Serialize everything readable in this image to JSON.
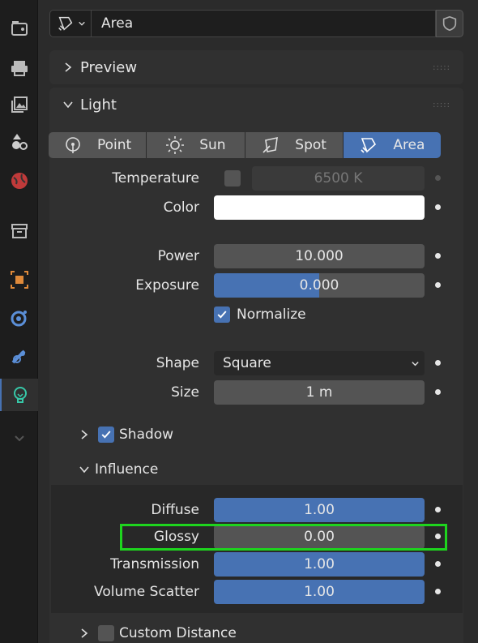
{
  "header": {
    "datablock_name": "Area",
    "icons": {
      "datablock": "area-light-icon",
      "fake_user": "shield-icon"
    }
  },
  "panels": {
    "preview": {
      "label": "Preview"
    },
    "light": {
      "label": "Light"
    }
  },
  "light_types": [
    {
      "label": "Point",
      "icon": "point-light-icon",
      "active": false
    },
    {
      "label": "Sun",
      "icon": "sun-light-icon",
      "active": false
    },
    {
      "label": "Spot",
      "icon": "spot-light-icon",
      "active": false
    },
    {
      "label": "Area",
      "icon": "area-light-icon",
      "active": true
    }
  ],
  "properties": {
    "temperature": {
      "label": "Temperature",
      "value": "6500 K",
      "enabled": false
    },
    "color": {
      "label": "Color",
      "value": "#ffffff"
    },
    "power": {
      "label": "Power",
      "value": "10.000"
    },
    "exposure": {
      "label": "Exposure",
      "value": "0.000",
      "fill": 0.5
    },
    "normalize": {
      "label": "Normalize",
      "checked": true
    },
    "shape": {
      "label": "Shape",
      "value": "Square"
    },
    "size": {
      "label": "Size",
      "value": "1 m"
    }
  },
  "shadow": {
    "label": "Shadow",
    "checked": true
  },
  "influence": {
    "label": "Influence",
    "rows": [
      {
        "key": "diffuse",
        "label": "Diffuse",
        "value": "1.00",
        "fill": 1.0
      },
      {
        "key": "glossy",
        "label": "Glossy",
        "value": "0.00",
        "fill": 0.0
      },
      {
        "key": "transmission",
        "label": "Transmission",
        "value": "1.00",
        "fill": 1.0
      },
      {
        "key": "volume",
        "label": "Volume Scatter",
        "value": "1.00",
        "fill": 1.0
      }
    ]
  },
  "custom_distance": {
    "label": "Custom Distance",
    "checked": false
  },
  "colors": {
    "accent": "#4772b3",
    "highlight": "#1ed41e",
    "field": "#545454",
    "panel": "#303030"
  }
}
